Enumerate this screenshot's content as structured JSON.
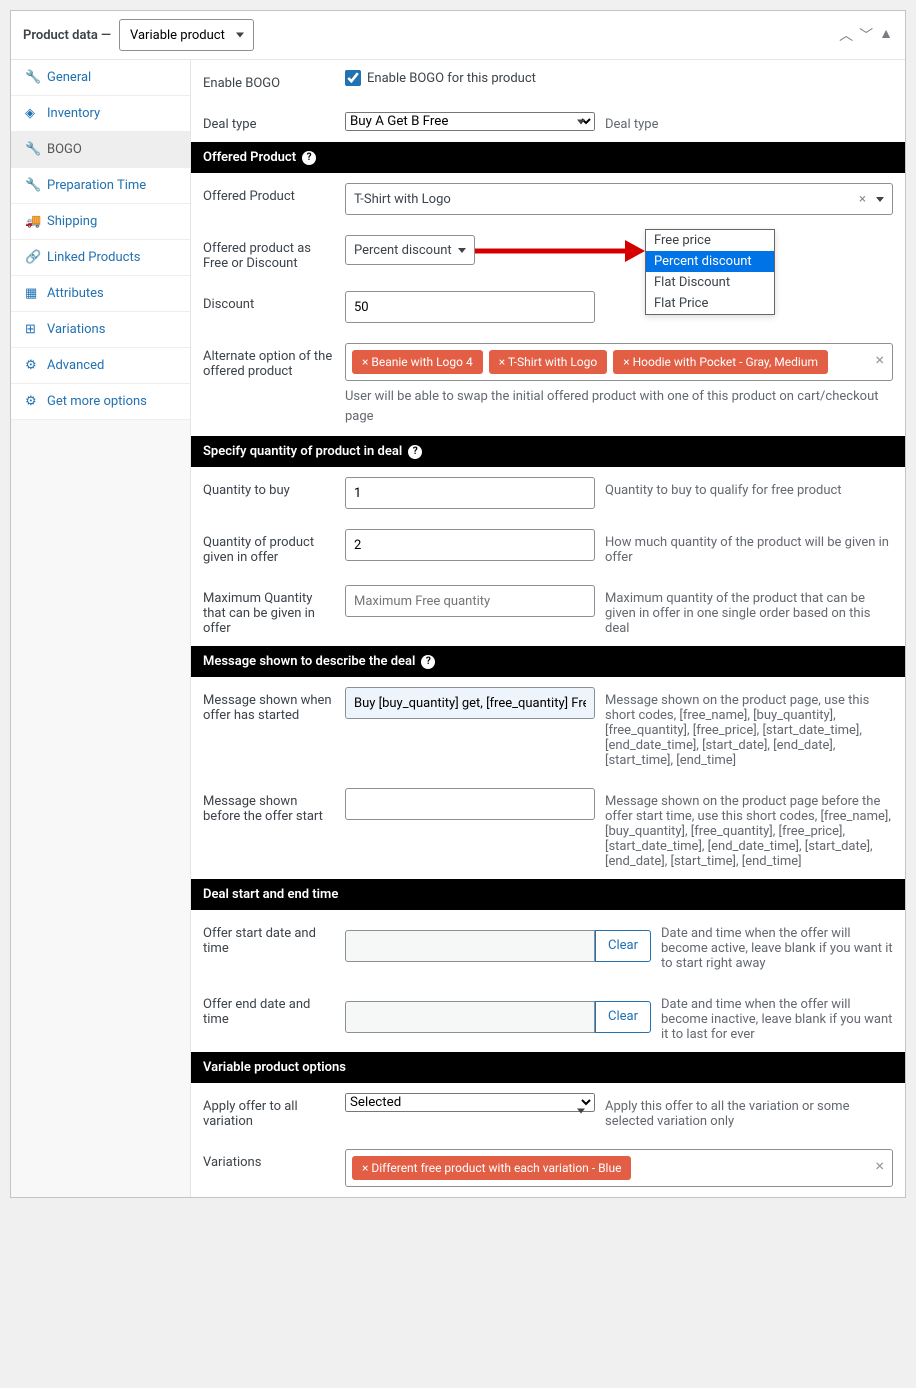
{
  "header": {
    "title": "Product data —",
    "product_type": "Variable product"
  },
  "sidebar": {
    "items": [
      {
        "label": "General",
        "icon": "wrench"
      },
      {
        "label": "Inventory",
        "icon": "diamond"
      },
      {
        "label": "BOGO",
        "icon": "wrench",
        "active": true
      },
      {
        "label": "Preparation Time",
        "icon": "wrench"
      },
      {
        "label": "Shipping",
        "icon": "truck"
      },
      {
        "label": "Linked Products",
        "icon": "link"
      },
      {
        "label": "Attributes",
        "icon": "layout"
      },
      {
        "label": "Variations",
        "icon": "grid"
      },
      {
        "label": "Advanced",
        "icon": "gear"
      },
      {
        "label": "Get more options",
        "icon": "gear"
      }
    ]
  },
  "enable_bogo": {
    "label": "Enable BOGO",
    "checkbox_label": "Enable BOGO for this product",
    "checked": true
  },
  "deal_type": {
    "label": "Deal type",
    "value": "Buy A Get B Free",
    "hint": "Deal type"
  },
  "sections": {
    "offered_product": "Offered Product",
    "quantity": "Specify quantity of product in deal",
    "message": "Message shown to describe the deal",
    "time": "Deal start and end time",
    "variable": "Variable product options"
  },
  "offered_product": {
    "label": "Offered Product",
    "value": "T-Shirt with Logo",
    "free_or_discount_label": "Offered product as Free or Discount",
    "free_or_discount_value": "Percent discount",
    "dropdown_options": [
      "Free price",
      "Percent discount",
      "Flat Discount",
      "Flat Price"
    ],
    "discount_label": "Discount",
    "discount_value": "50",
    "alternate_label": "Alternate option of the offered product",
    "alternate_tags": [
      "× Beanie with Logo 4",
      "× T-Shirt with Logo",
      "× Hoodie with Pocket - Gray, Medium"
    ],
    "alternate_hint": "User will be able to swap the initial offered product with one of this product on cart/checkout page"
  },
  "quantity": {
    "buy_label": "Quantity to buy",
    "buy_value": "1",
    "buy_hint": "Quantity to buy to qualify for free product",
    "given_label": "Quantity of product given in offer",
    "given_value": "2",
    "given_hint": "How much quantity of the product will be given in offer",
    "max_label": "Maximum Quantity that can be given in offer",
    "max_placeholder": "Maximum Free quantity",
    "max_hint": "Maximum quantity of the product that can be given in offer in one single order based on this deal"
  },
  "message": {
    "started_label": "Message shown when offer has started",
    "started_value": "Buy [buy_quantity] get, [free_quantity] Free",
    "started_hint": "Message shown on the product page, use this short codes, [free_name], [buy_quantity], [free_quantity], [free_price], [start_date_time], [end_date_time], [start_date], [end_date], [start_time], [end_time]",
    "before_label": "Message shown before the offer start",
    "before_hint": "Message shown on the product page before the offer start time, use this short codes, [free_name], [buy_quantity], [free_quantity], [free_price], [start_date_time], [end_date_time], [start_date], [end_date], [start_time], [end_time]"
  },
  "time": {
    "start_label": "Offer start date and time",
    "start_hint": "Date and time when the offer will become active, leave blank if you want it to start right away",
    "end_label": "Offer end date and time",
    "end_hint": "Date and time when the offer will become inactive, leave blank if you want it to last for ever",
    "clear_btn": "Clear"
  },
  "variable": {
    "apply_label": "Apply offer to all variation",
    "apply_value": "Selected",
    "apply_hint": "Apply this offer to all the variation or some selected variation only",
    "variations_label": "Variations",
    "variations_tags": [
      "× Different free product with each variation - Blue"
    ]
  }
}
